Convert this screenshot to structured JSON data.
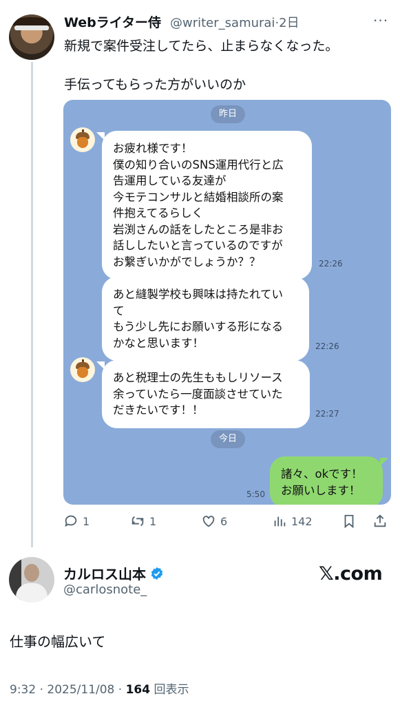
{
  "tweet1": {
    "display_name": "Webライター侍",
    "handle": "@writer_samurai",
    "time": "·2日",
    "more_icon": "···",
    "text_line1": "新規で案件受注してたら、止まらなくなった。",
    "text_line2": "手伝ってもらった方がいいのか",
    "line_chat": {
      "date_yesterday": "昨日",
      "date_today": "今日",
      "messages": [
        {
          "text": "お疲れ様です！\n僕の知り合いのSNS運用代行と広\n告運用している友達が\n今モテコンサルと結婚相談所の案\n件抱えてるらしく\n岩渕さんの話をしたところ是非お\n話ししたいと言っているのですが\nお繋ぎいかがでしょうか？？",
          "time": "22:26"
        },
        {
          "text": "あと縫製学校も興味は持たれてい\nて\nもう少し先にお願いする形になる\nかなと思います！",
          "time": "22:26"
        },
        {
          "text": "あと税理士の先生ももしリソース\n余っていたら一度面談させていた\nだきたいです！！",
          "time": "22:27"
        }
      ],
      "reply": {
        "text": "諸々、okです！\nお願いします！",
        "time": "5:50"
      }
    },
    "actions": {
      "replies": "1",
      "retweets": "1",
      "likes": "6",
      "views": "142"
    }
  },
  "tweet2": {
    "display_name": "カルロス山本",
    "handle": "@carlosnote_",
    "brand": "𝕏.com",
    "text": "仕事の幅広いて",
    "meta_prefix": "9:32 · 2025/11/08 · ",
    "views_count": "164",
    "views_label": " 回表示"
  },
  "colors": {
    "line_bg": "#8aabd9",
    "green_bubble": "#8fd86f",
    "verified": "#1d9bf0"
  }
}
